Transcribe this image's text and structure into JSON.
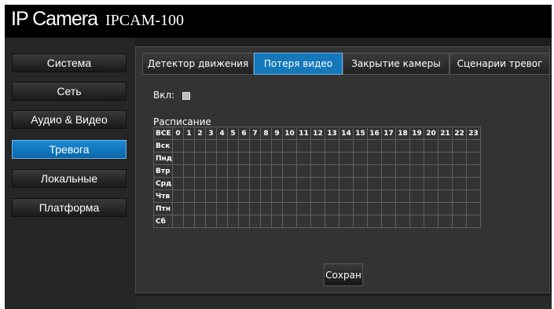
{
  "header": {
    "brand": "IP Camera",
    "model": "IPCAM-100"
  },
  "sidebar": {
    "items": [
      {
        "label": "Система"
      },
      {
        "label": "Сеть"
      },
      {
        "label": "Аудио & Видео"
      },
      {
        "label": "Тревога",
        "active": true
      },
      {
        "label": "Локальные"
      },
      {
        "label": "Платформа"
      }
    ]
  },
  "tabs": [
    {
      "label": "Детектор движения"
    },
    {
      "label": "Потеря видео",
      "active": true
    },
    {
      "label": "Закрытие камеры"
    },
    {
      "label": "Сценарии тревог"
    }
  ],
  "form": {
    "enable_label": "Вкл:",
    "enabled": false,
    "schedule_label": "Расписание"
  },
  "schedule": {
    "corner": "ВСЕ",
    "hours": [
      "0",
      "1",
      "2",
      "3",
      "4",
      "5",
      "6",
      "7",
      "8",
      "9",
      "10",
      "11",
      "12",
      "13",
      "14",
      "15",
      "16",
      "17",
      "18",
      "19",
      "20",
      "21",
      "22",
      "23"
    ],
    "days": [
      "Вск",
      "Пнд",
      "Втр",
      "Срд",
      "Чтв",
      "Птн",
      "Сб"
    ]
  },
  "actions": {
    "save_label": "Сохран"
  },
  "colors": {
    "accent": "#1478bb",
    "background": "#1e1e1e",
    "panel": "#333333"
  }
}
